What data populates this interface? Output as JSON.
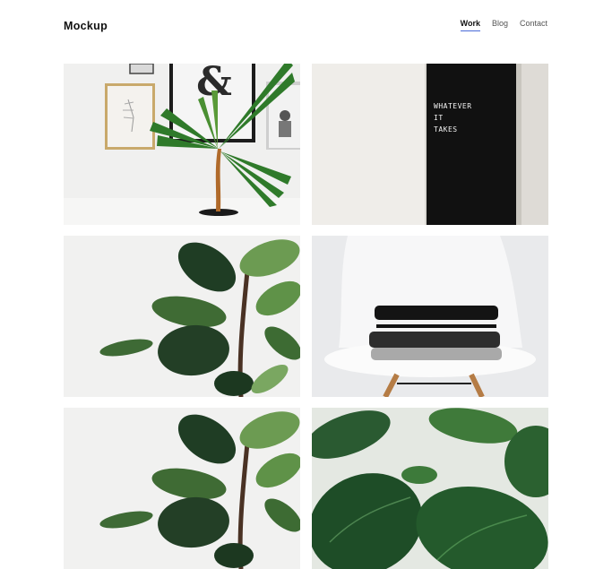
{
  "header": {
    "brand": "Mockup",
    "nav": [
      {
        "label": "Work",
        "active": true
      },
      {
        "label": "Blog",
        "active": false
      },
      {
        "label": "Contact",
        "active": false
      }
    ]
  },
  "gallery": {
    "tiles": [
      {
        "subject": "palm-plant-with-frames",
        "frame_glyph": "&"
      },
      {
        "subject": "letter-board",
        "board_lines": [
          "WHATEVER",
          "IT",
          "TAKES"
        ]
      },
      {
        "subject": "fiddle-leaf-fig"
      },
      {
        "subject": "folded-clothes-on-chair"
      },
      {
        "subject": "fiddle-leaf-fig"
      },
      {
        "subject": "monstera-leaves"
      }
    ]
  },
  "colors": {
    "accent": "#4a6bd8",
    "text": "#111111",
    "nav_text": "#555555",
    "leaf_dark": "#1f3d24",
    "leaf_light": "#4f8a3d"
  }
}
